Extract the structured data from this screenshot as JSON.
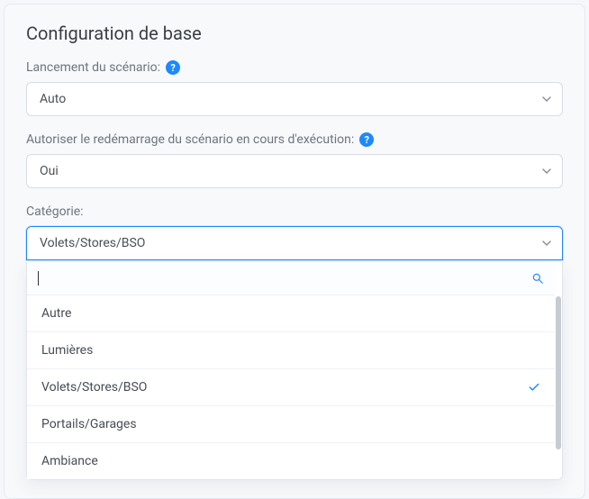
{
  "title": "Configuration de base",
  "labels": {
    "launch": "Lancement du scénario:",
    "restart": "Autoriser le redémarrage du scénario en cours d'exécution:",
    "category": "Catégorie:"
  },
  "selects": {
    "launch_value": "Auto",
    "restart_value": "Oui",
    "category_value": "Volets/Stores/BSO"
  },
  "search": {
    "placeholder": ""
  },
  "category_options": [
    {
      "label": "Autre",
      "selected": false
    },
    {
      "label": "Lumières",
      "selected": false
    },
    {
      "label": "Volets/Stores/BSO",
      "selected": true
    },
    {
      "label": "Portails/Garages",
      "selected": false
    },
    {
      "label": "Ambiance",
      "selected": false
    }
  ],
  "help_glyph": "?"
}
